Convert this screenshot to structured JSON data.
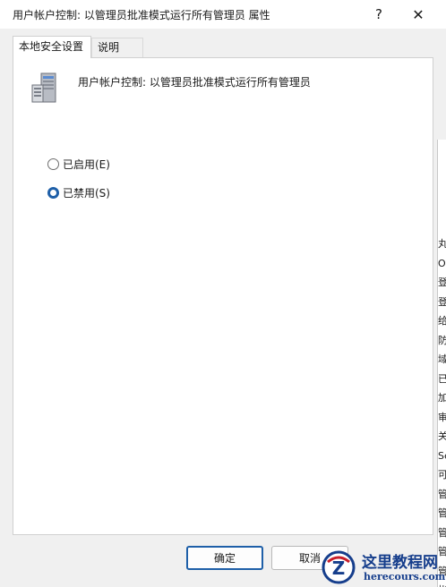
{
  "window": {
    "title": "用户帐户控制: 以管理员批准模式运行所有管理员 属性",
    "help_label": "?",
    "close_label": "✕"
  },
  "tabs": [
    {
      "label": "本地安全设置"
    },
    {
      "label": "说明"
    }
  ],
  "panel": {
    "policy_title": "用户帐户控制: 以管理员批准模式运行所有管理员",
    "icon": "server-icon",
    "options": [
      {
        "label": "已启用(E)",
        "checked": false
      },
      {
        "label": "已禁用(S)",
        "checked": true
      }
    ]
  },
  "footer": {
    "ok_label": "确定",
    "cancel_label": "取消"
  },
  "background_window": {
    "lines": [
      "丸",
      "OL",
      "登",
      "登",
      "给",
      "防",
      "域",
      "已",
      "加",
      "审",
      "关",
      "Ses",
      "可",
      "管",
      "管",
      "管",
      "管",
      "管",
      "帐"
    ]
  },
  "watermark": {
    "line1": "这里教程网",
    "line2": "herecours.com",
    "accent": "#163e8c"
  }
}
